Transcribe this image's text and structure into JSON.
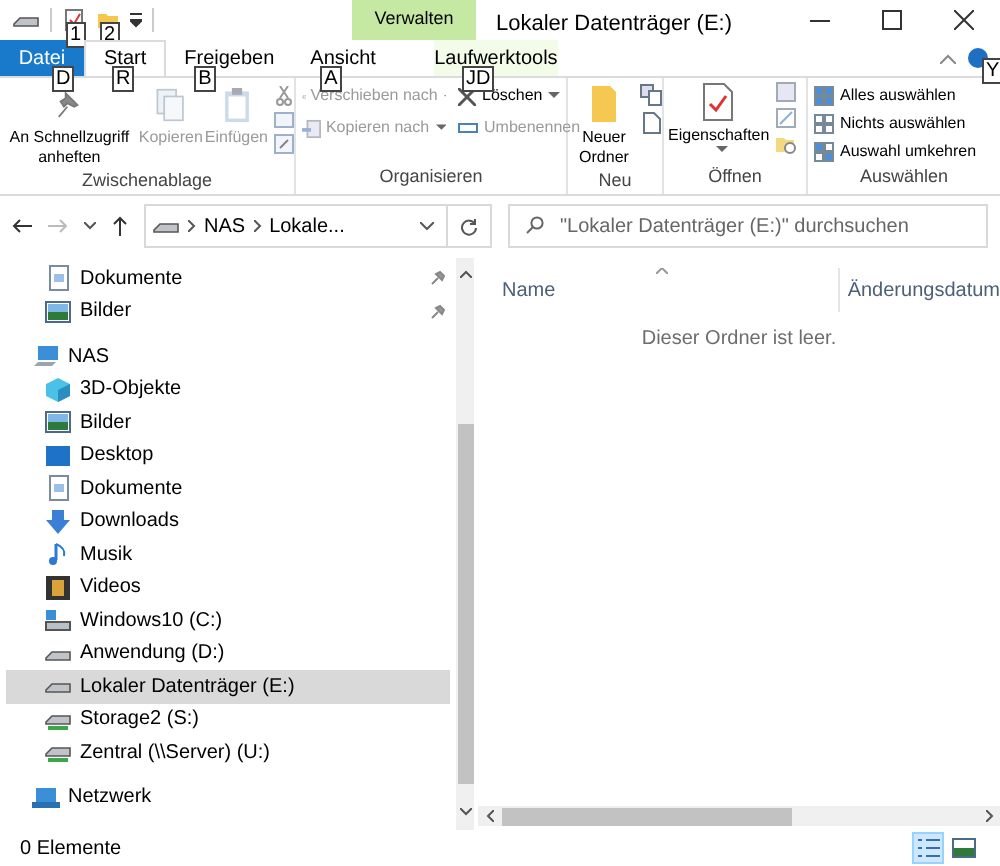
{
  "quick_access_toolbar": {
    "keytips": [
      "1",
      "2"
    ]
  },
  "contextual_tab": {
    "label": "Verwalten"
  },
  "window": {
    "title": "Lokaler Datenträger (E:)"
  },
  "tabs": [
    {
      "label": "Datei",
      "kind": "file",
      "selected": false,
      "keytip": "D"
    },
    {
      "label": "Start",
      "kind": "normal",
      "selected": true,
      "keytip": "R"
    },
    {
      "label": "Freigeben",
      "kind": "normal",
      "selected": false,
      "keytip": "B"
    },
    {
      "label": "Ansicht",
      "kind": "normal",
      "selected": false,
      "keytip": "A"
    },
    {
      "label": "Laufwerktools",
      "kind": "contextual",
      "selected": false,
      "keytip": "JD"
    }
  ],
  "help": {
    "keytip": "Y"
  },
  "ribbon": {
    "groups": [
      {
        "label": "Zwischenablage",
        "buttons": [
          {
            "label": "An Schnellzugriff anheften",
            "disabled": false
          },
          {
            "label": "Kopieren",
            "disabled": true
          },
          {
            "label": "Einfügen",
            "disabled": true
          }
        ]
      },
      {
        "label": "Organisieren",
        "buttons": [
          {
            "label": "Verschieben nach",
            "disabled": true
          },
          {
            "label": "Kopieren nach",
            "disabled": true
          },
          {
            "label": "Löschen",
            "disabled": false
          },
          {
            "label": "Umbenennen",
            "disabled": true
          }
        ]
      },
      {
        "label": "Neu",
        "buttons": [
          {
            "label": "Neuer Ordner",
            "disabled": false
          }
        ]
      },
      {
        "label": "Öffnen",
        "buttons": [
          {
            "label": "Eigenschaften",
            "disabled": false
          }
        ]
      },
      {
        "label": "Auswählen",
        "buttons": [
          {
            "label": "Alles auswählen",
            "disabled": false
          },
          {
            "label": "Nichts auswählen",
            "disabled": false
          },
          {
            "label": "Auswahl umkehren",
            "disabled": false
          }
        ]
      }
    ]
  },
  "address_bar": {
    "breadcrumbs": [
      "NAS",
      "Lokale..."
    ],
    "back_disabled": false,
    "forward_disabled": true
  },
  "search": {
    "placeholder": "\"Lokaler Datenträger (E:)\" durchsuchen"
  },
  "navigation_pane": {
    "quick_access_items": [
      {
        "label": "Dokumente",
        "kind": "document",
        "pinned": true,
        "selected": false
      },
      {
        "label": "Bilder",
        "kind": "picture",
        "pinned": true,
        "selected": false
      }
    ],
    "tree": [
      {
        "label": "NAS",
        "kind": "pc",
        "selected": false,
        "children": [
          {
            "label": "3D-Objekte",
            "kind": "cube",
            "selected": false
          },
          {
            "label": "Bilder",
            "kind": "picture",
            "selected": false
          },
          {
            "label": "Desktop",
            "kind": "desktop",
            "selected": false
          },
          {
            "label": "Dokumente",
            "kind": "document",
            "selected": false
          },
          {
            "label": "Downloads",
            "kind": "download",
            "selected": false
          },
          {
            "label": "Musik",
            "kind": "music",
            "selected": false
          },
          {
            "label": "Videos",
            "kind": "video",
            "selected": false
          },
          {
            "label": "Windows10 (C:)",
            "kind": "system-drive",
            "selected": false
          },
          {
            "label": "Anwendung (D:)",
            "kind": "drive",
            "selected": false
          },
          {
            "label": "Lokaler Datenträger (E:)",
            "kind": "drive",
            "selected": true
          },
          {
            "label": "Storage2 (S:)",
            "kind": "network-drive",
            "selected": false
          },
          {
            "label": "Zentral (\\\\Server) (U:)",
            "kind": "network-drive",
            "selected": false
          }
        ]
      },
      {
        "label": "Netzwerk",
        "kind": "network",
        "selected": false
      }
    ]
  },
  "file_list": {
    "columns": [
      {
        "label": "Name",
        "sorted": true
      },
      {
        "label": "Änderungsdatum",
        "sorted": false
      }
    ],
    "empty_message": "Dieser Ordner ist leer."
  },
  "status_bar": {
    "item_count": "0 Elemente",
    "views": [
      {
        "kind": "details",
        "selected": true
      },
      {
        "kind": "large-icons",
        "selected": false
      }
    ]
  }
}
